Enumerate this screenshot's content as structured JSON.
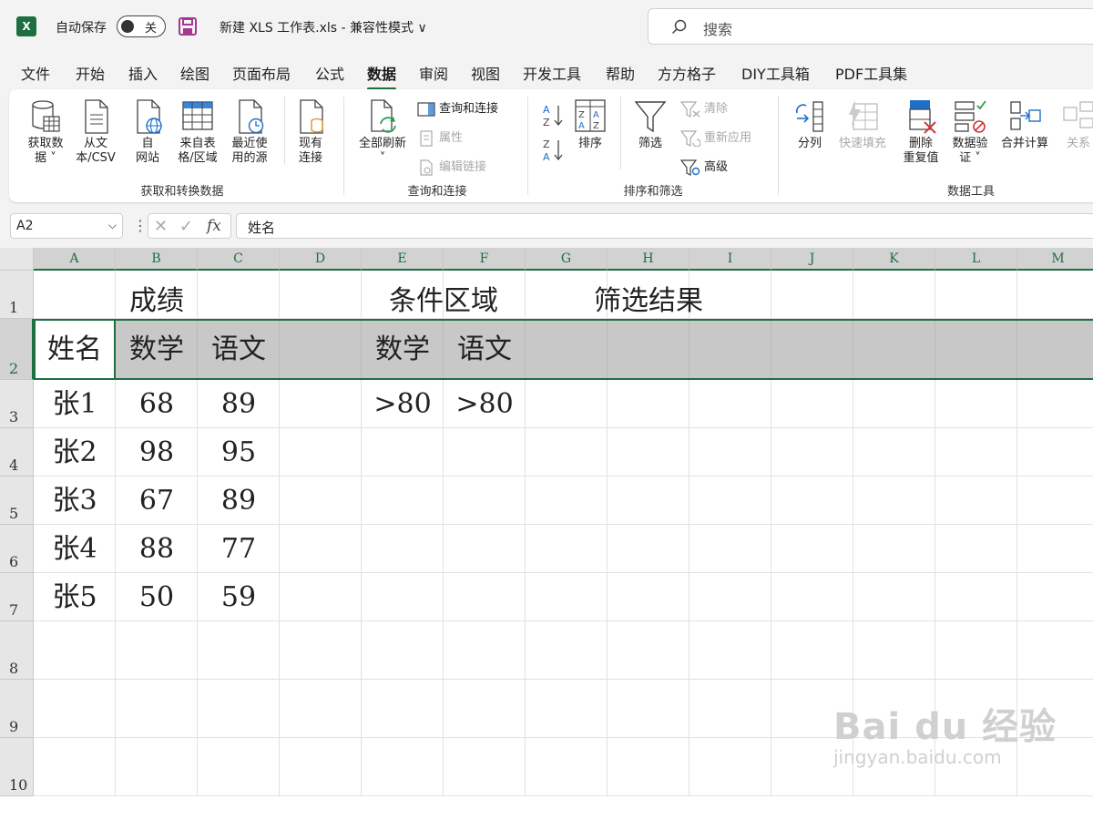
{
  "titlebar": {
    "app_icon": "excel-logo",
    "autosave_label": "自动保存",
    "autosave_state": "关",
    "document_title": "新建 XLS 工作表.xls  -  兼容性模式 ∨",
    "search_placeholder": "搜索"
  },
  "tabs": [
    "文件",
    "开始",
    "插入",
    "绘图",
    "页面布局",
    "公式",
    "数据",
    "审阅",
    "视图",
    "开发工具",
    "帮助",
    "方方格子",
    "DIY工具箱",
    "PDF工具集"
  ],
  "active_tab": "数据",
  "ribbon": {
    "get_transform": {
      "label": "获取和转换数据",
      "buttons": [
        {
          "l1": "获取数",
          "l2": "据 ˅"
        },
        {
          "l1": "从文",
          "l2": "本/CSV"
        },
        {
          "l1": "自",
          "l2": "网站"
        },
        {
          "l1": "来自表",
          "l2": "格/区域"
        },
        {
          "l1": "最近使",
          "l2": "用的源"
        },
        {
          "l1": "现有",
          "l2": "连接"
        }
      ]
    },
    "query_connect": {
      "label": "查询和连接",
      "refresh_l1": "全部刷新",
      "refresh_l2": "˅",
      "items": [
        "查询和连接",
        "属性",
        "编辑链接"
      ]
    },
    "sort_filter": {
      "label": "排序和筛选",
      "sort": "排序",
      "filter": "筛选",
      "items": [
        "清除",
        "重新应用",
        "高级"
      ]
    },
    "data_tools": {
      "label": "数据工具",
      "buttons": [
        {
          "l1": "分列",
          "l2": ""
        },
        {
          "l1": "快速填充",
          "l2": ""
        },
        {
          "l1": "删除",
          "l2": "重复值"
        },
        {
          "l1": "数据验",
          "l2": "证 ˅"
        },
        {
          "l1": "合并计算",
          "l2": ""
        },
        {
          "l1": "关系",
          "l2": ""
        }
      ]
    }
  },
  "formula_bar": {
    "name_box": "A2",
    "fx": "fx",
    "content": "姓名"
  },
  "columns": [
    "A",
    "B",
    "C",
    "D",
    "E",
    "F",
    "G",
    "H",
    "I",
    "J",
    "K",
    "L",
    "M"
  ],
  "rows": [
    "1",
    "2",
    "3",
    "4",
    "5",
    "6",
    "7",
    "8",
    "9",
    "10"
  ],
  "sheet": {
    "title_scores": "成绩",
    "title_criteria": "条件区域",
    "title_results": "筛选结果",
    "header_name": "姓名",
    "header_math": "数学",
    "header_chinese": "语文",
    "criteria_math": "数学",
    "criteria_chinese": "语文",
    "criteria_math_val": ">80",
    "criteria_chinese_val": ">80",
    "records": [
      {
        "name": "张1",
        "math": "68",
        "chinese": "89"
      },
      {
        "name": "张2",
        "math": "98",
        "chinese": "95"
      },
      {
        "name": "张3",
        "math": "67",
        "chinese": "89"
      },
      {
        "name": "张4",
        "math": "88",
        "chinese": "77"
      },
      {
        "name": "张5",
        "math": "50",
        "chinese": "59"
      }
    ]
  },
  "watermark": {
    "brand": "Bai du 经验",
    "url": "jingyan.baidu.com"
  }
}
